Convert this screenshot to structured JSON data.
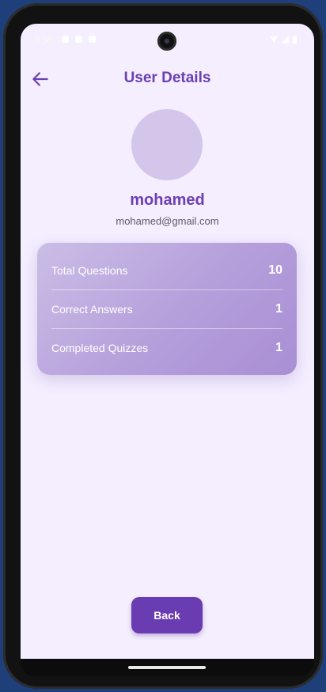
{
  "status_bar": {
    "time": "9:56"
  },
  "appbar": {
    "title": "User Details",
    "back_icon": "arrow-left-icon"
  },
  "profile": {
    "name": "mohamed",
    "email": "mohamed@gmail.com"
  },
  "stats": [
    {
      "label": "Total Questions",
      "value": "10"
    },
    {
      "label": "Correct Answers",
      "value": "1"
    },
    {
      "label": "Completed Quizzes",
      "value": "1"
    }
  ],
  "actions": {
    "back_label": "Back"
  },
  "colors": {
    "accent": "#6a3cb2",
    "background": "#f4eeff",
    "avatar": "#d3c6ea"
  }
}
